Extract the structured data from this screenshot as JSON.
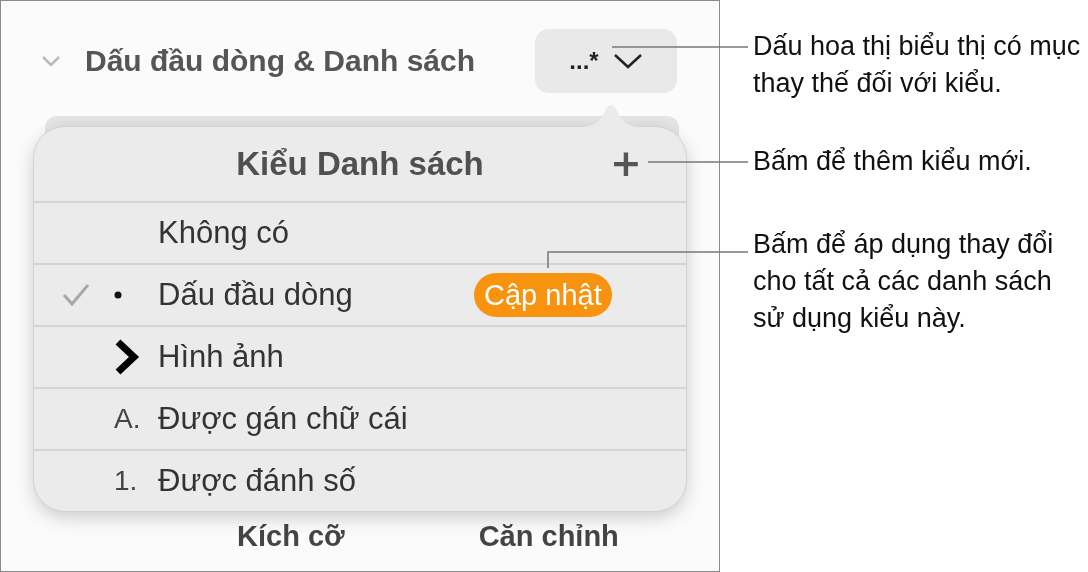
{
  "section": {
    "title": "Dấu đầu dòng & Danh sách",
    "expanded": true,
    "style_button": "...*"
  },
  "popover": {
    "title": "Kiểu Danh sách",
    "add": "+",
    "rows": [
      {
        "kind": "none",
        "label": "Không có",
        "checked": false
      },
      {
        "kind": "bullet",
        "label": "Dấu đầu dòng",
        "checked": true,
        "action": "Cập nhật"
      },
      {
        "kind": "image",
        "label": "Hình ảnh",
        "checked": false
      },
      {
        "kind": "letter",
        "marker": "A.",
        "label": "Được gán chữ cái",
        "checked": false
      },
      {
        "kind": "number",
        "marker": "1.",
        "label": "Được đánh số",
        "checked": false
      }
    ]
  },
  "bottom_labels": [
    "Kích cỡ",
    "Căn chỉnh"
  ],
  "callouts": [
    "Dấu hoa thị biểu thị có mục thay thế đối với kiểu.",
    "Bấm để thêm kiểu mới.",
    "Bấm để áp dụng thay đổi cho tất cả các danh sách sử dụng kiểu này."
  ]
}
